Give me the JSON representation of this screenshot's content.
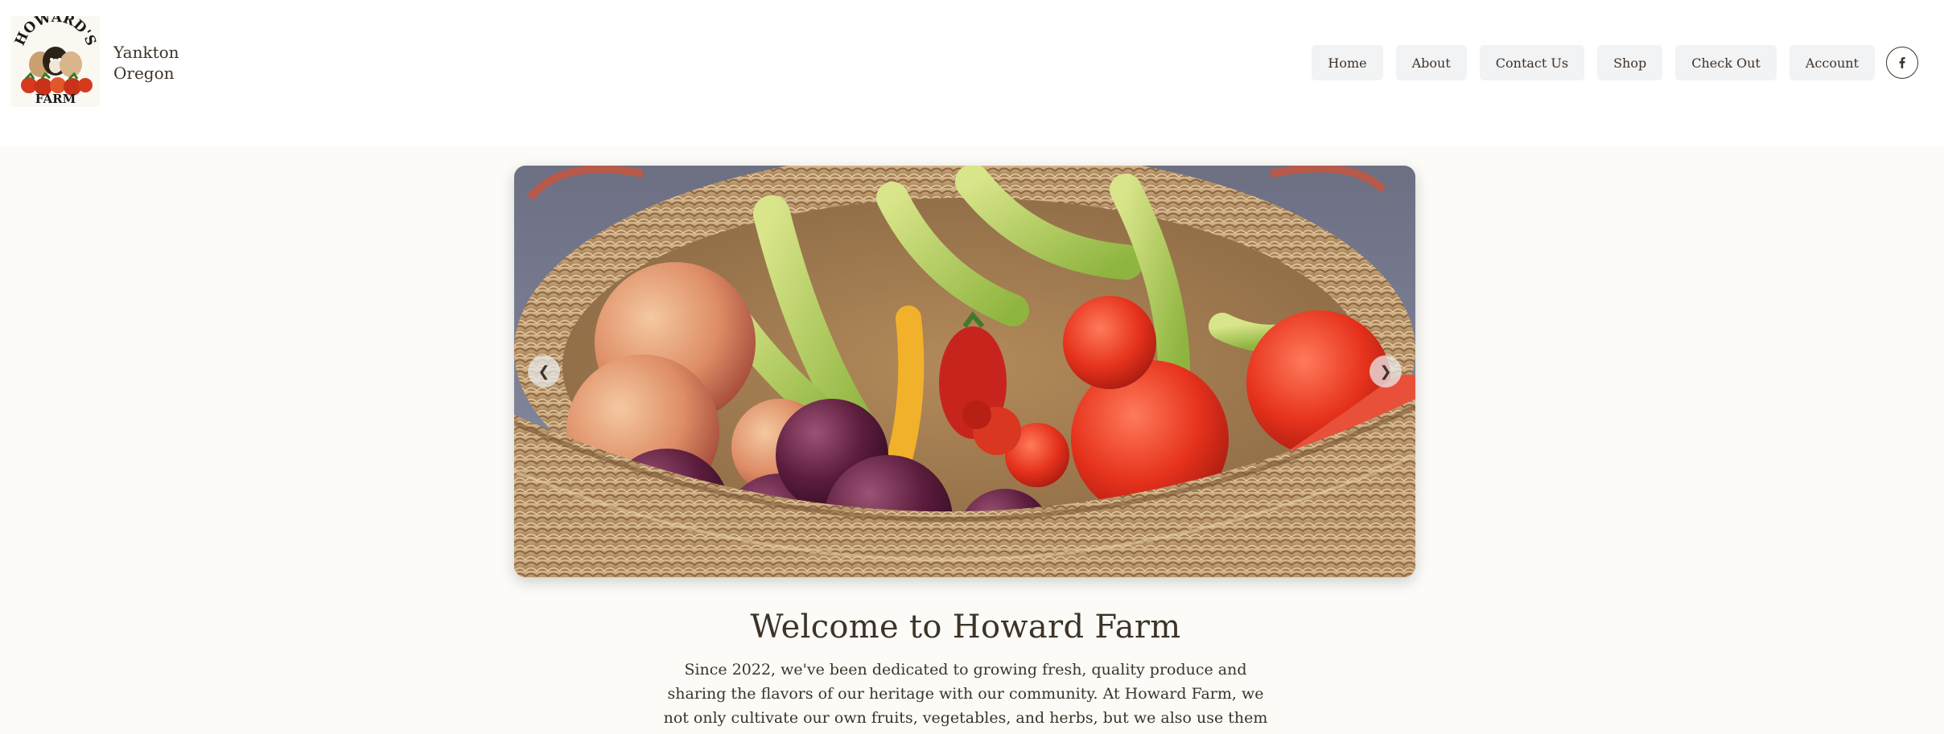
{
  "site": {
    "location_line1": "Yankton",
    "location_line2": "Oregon",
    "logo_top_text": "HOWARD'S",
    "logo_bottom_text": "FARM"
  },
  "nav": {
    "home": "Home",
    "about": "About",
    "contact": "Contact Us",
    "shop": "Shop",
    "checkout": "Check Out",
    "account": "Account"
  },
  "carousel": {
    "prev_glyph": "❮",
    "next_glyph": "❯"
  },
  "welcome": {
    "title": "Welcome to Howard Farm",
    "body": "Since 2022, we've been dedicated to growing fresh, quality produce and sharing the flavors of our heritage with our community. At Howard Farm, we not only cultivate our own fruits, vegetables, and herbs, but we also use them to create delicious, homemade recipes inspired by"
  },
  "colors": {
    "text": "#3d3328",
    "nav_bg": "#f2f3f5",
    "page_bg": "#fcfbf8"
  },
  "icons": {
    "social": "facebook-icon"
  }
}
